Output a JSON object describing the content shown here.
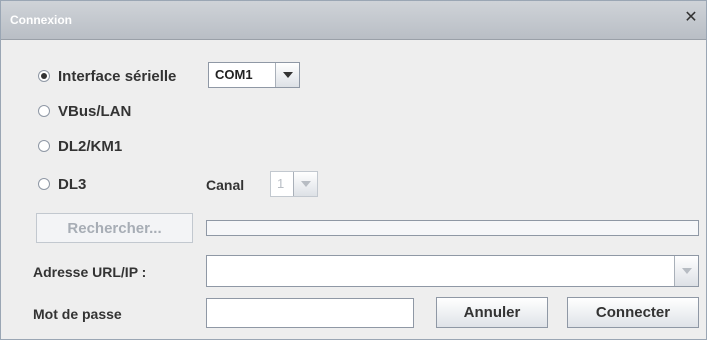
{
  "window": {
    "title": "Connexion",
    "close_icon": "close-icon"
  },
  "connection_types": [
    {
      "label": "Interface sérielle",
      "selected": true
    },
    {
      "label": "VBus/LAN",
      "selected": false
    },
    {
      "label": "DL2/KM1",
      "selected": false
    },
    {
      "label": "DL3",
      "selected": false
    }
  ],
  "serial_port": {
    "value": "COM1"
  },
  "canal": {
    "label": "Canal",
    "value": "1"
  },
  "search": {
    "button_label": "Rechercher...",
    "progress": 0
  },
  "url": {
    "label": "Adresse URL/IP :",
    "value": ""
  },
  "password": {
    "label": "Mot de passe",
    "value": ""
  },
  "actions": {
    "cancel_label": "Annuler",
    "connect_label": "Connecter"
  }
}
